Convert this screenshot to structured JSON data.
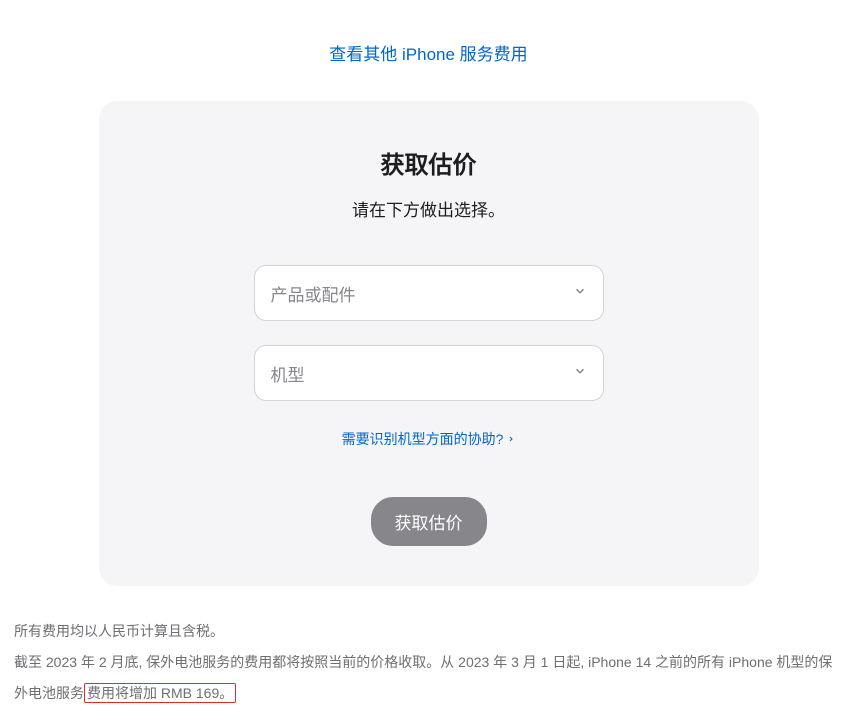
{
  "topLink": "查看其他 iPhone 服务费用",
  "card": {
    "title": "获取估价",
    "subtitle": "请在下方做出选择。",
    "selects": {
      "product": "产品或配件",
      "model": "机型"
    },
    "helpLink": "需要识别机型方面的协助?",
    "button": "获取估价"
  },
  "footer": {
    "line1": "所有费用均以人民币计算且含税。",
    "line2_part1": "截至 2023 年 2 月底, 保外电池服务的费用都将按照当前的价格收取。从 2023 年 3 月 1 日起, iPhone 14 之前的所有 iPhone 机型的保外电池服务",
    "line2_part2": "费用将增加 RMB 169。"
  }
}
